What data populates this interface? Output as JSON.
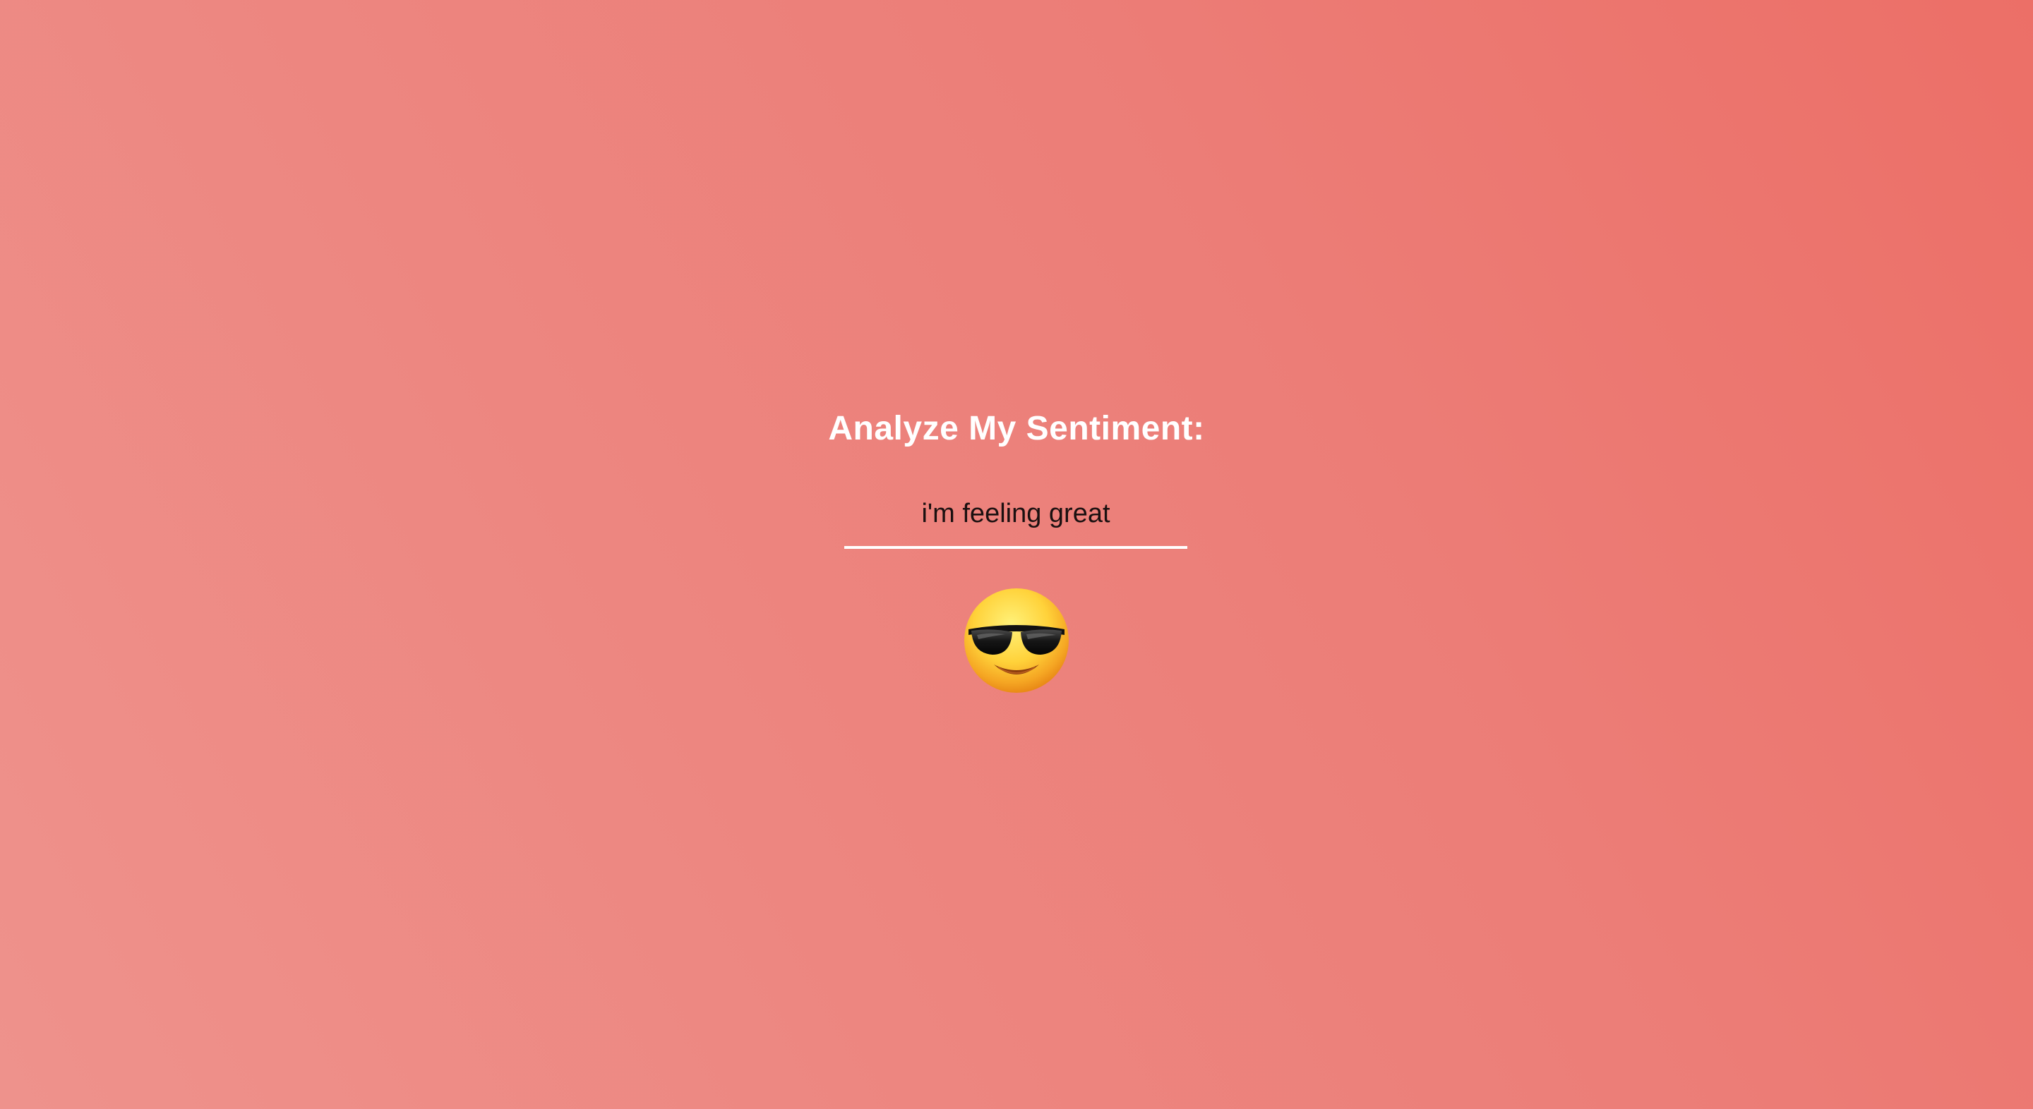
{
  "app": {
    "heading": "Analyze My Sentiment:"
  },
  "input": {
    "value": "i'm feeling great",
    "placeholder": ""
  },
  "result": {
    "emoji": "smiling-face-with-sunglasses-icon"
  },
  "colors": {
    "background_start": "#ee928c",
    "background_end": "#ec6f67",
    "text": "#ffffff",
    "underline": "#ffffff"
  }
}
